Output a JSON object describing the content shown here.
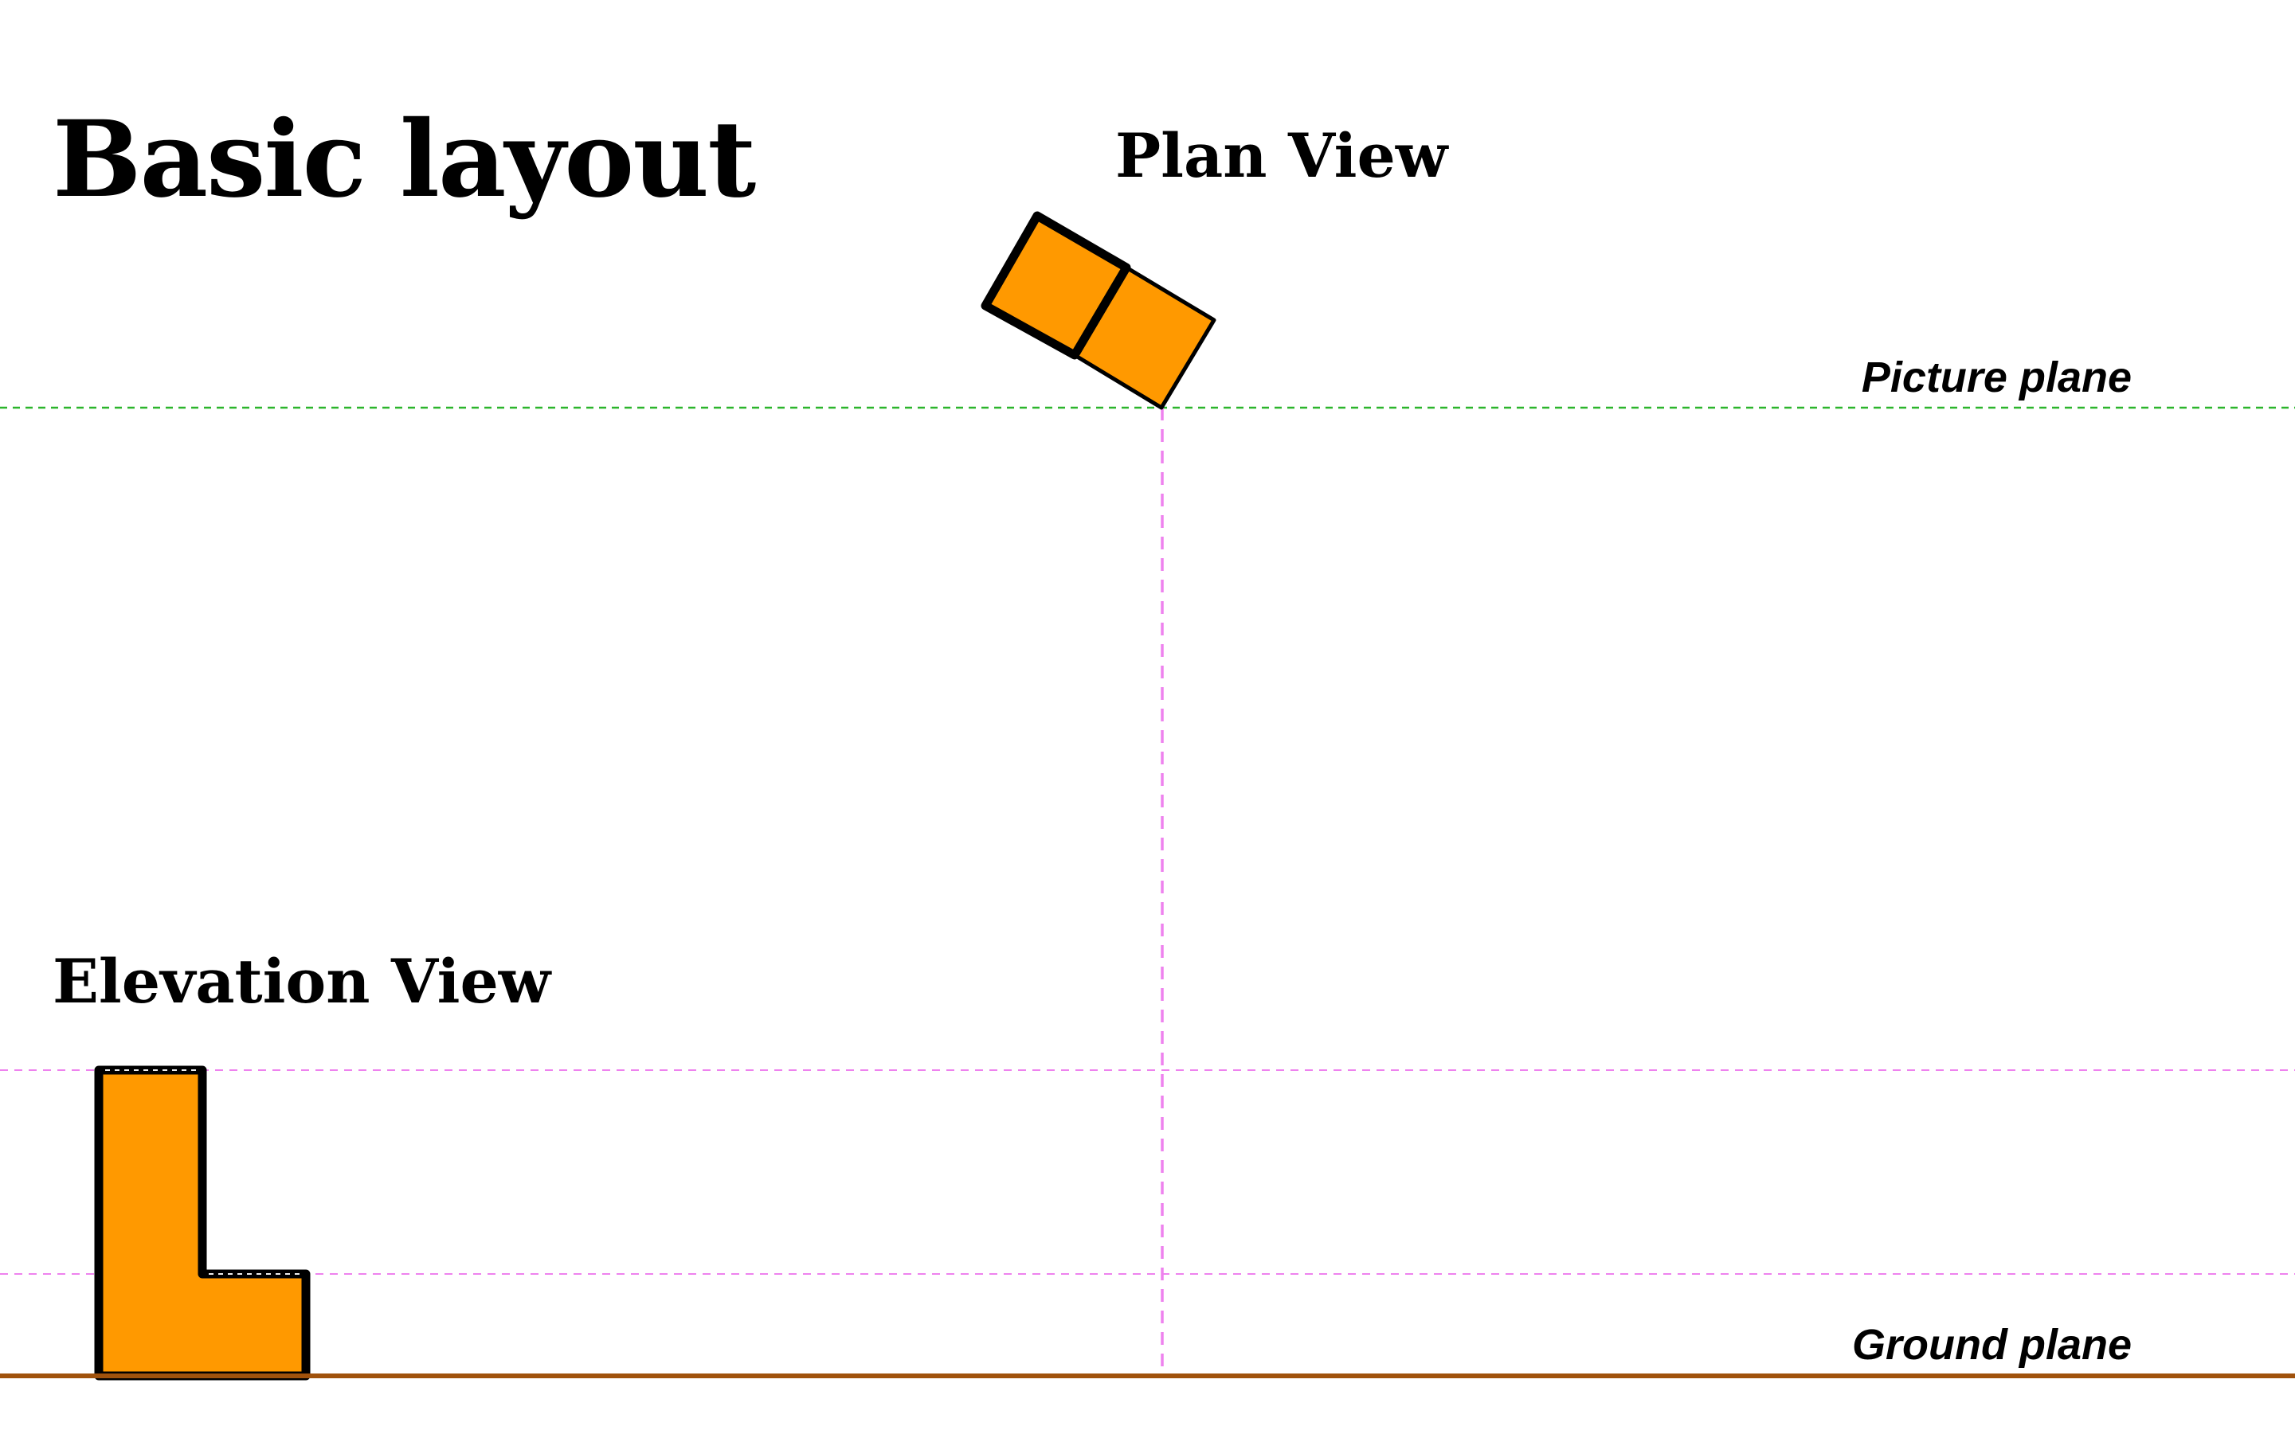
{
  "title": "Basic layout",
  "plan_view": {
    "label": "Plan View"
  },
  "elevation_view": {
    "label": "Elevation View"
  },
  "picture_plane": {
    "label": "Picture plane"
  },
  "ground_plane": {
    "label": "Ground plane"
  },
  "colors": {
    "object_fill": "#FF9900",
    "object_stroke": "#000000",
    "picture_plane_line": "#2BB52B",
    "projection_line": "#EE82EE",
    "ground_line": "#A0520C",
    "background": "#FFFFFF"
  }
}
